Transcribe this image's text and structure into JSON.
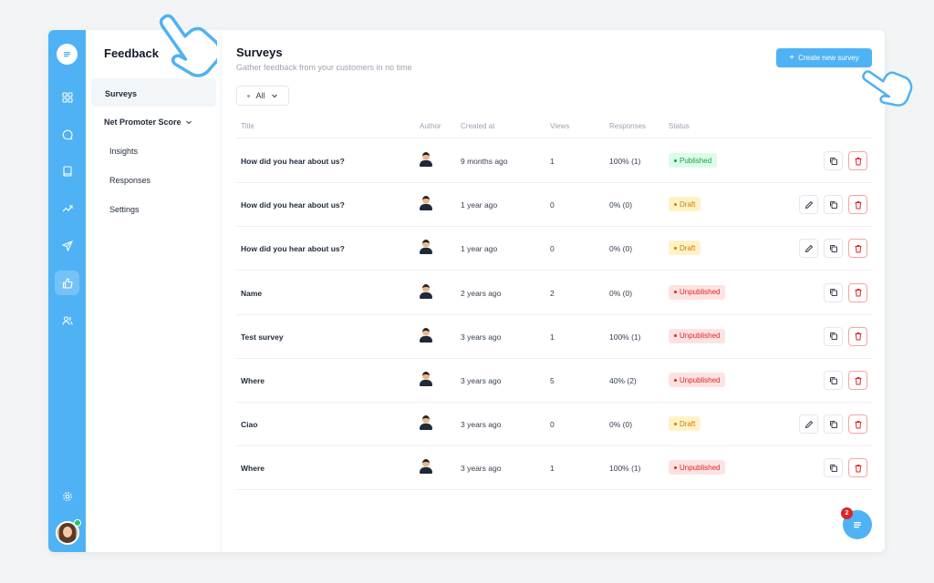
{
  "submenu": {
    "title": "Feedback",
    "items": [
      {
        "label": "Surveys"
      },
      {
        "label": "Net Promoter Score"
      },
      {
        "label": "Insights"
      },
      {
        "label": "Responses"
      },
      {
        "label": "Settings"
      }
    ]
  },
  "main": {
    "title": "Surveys",
    "subtitle": "Gather feedback from your customers in no time",
    "create_label": "Create new survey",
    "filter_label": "All"
  },
  "table": {
    "headers": [
      "Title",
      "Author",
      "Created at",
      "Views",
      "Responses",
      "Status"
    ],
    "rows": [
      {
        "title": "How did you hear about us?",
        "created": "9 months ago",
        "views": "1",
        "responses": "100% (1)",
        "status": "Published"
      },
      {
        "title": "How did you hear about us?",
        "created": "1 year ago",
        "views": "0",
        "responses": "0% (0)",
        "status": "Draft"
      },
      {
        "title": "How did you hear about us?",
        "created": "1 year ago",
        "views": "0",
        "responses": "0% (0)",
        "status": "Draft"
      },
      {
        "title": "Name",
        "created": "2 years ago",
        "views": "2",
        "responses": "0% (0)",
        "status": "Unpublished"
      },
      {
        "title": "Test survey",
        "created": "3 years ago",
        "views": "1",
        "responses": "100% (1)",
        "status": "Unpublished"
      },
      {
        "title": "Where",
        "created": "3 years ago",
        "views": "5",
        "responses": "40% (2)",
        "status": "Unpublished"
      },
      {
        "title": "Ciao",
        "created": "3 years ago",
        "views": "0",
        "responses": "0% (0)",
        "status": "Draft"
      },
      {
        "title": "Where",
        "created": "3 years ago",
        "views": "1",
        "responses": "100% (1)",
        "status": "Unpublished"
      }
    ]
  },
  "chat": {
    "badge_count": "2"
  },
  "colors": {
    "accent": "#4fb2f4",
    "published": "#16a34a",
    "draft": "#d97706",
    "unpublished": "#dc2626"
  },
  "icons": {
    "rail": [
      "chat-logo-icon",
      "dashboard-icon",
      "chat-icon",
      "book-icon",
      "trending-icon",
      "send-icon",
      "thumbs-up-icon",
      "users-icon",
      "settings-icon"
    ],
    "actions": [
      "edit-icon",
      "copy-icon",
      "trash-icon"
    ]
  }
}
